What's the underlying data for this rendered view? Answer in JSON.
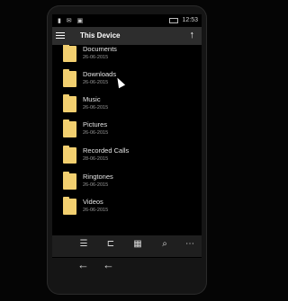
{
  "status_bar": {
    "time": "12:53"
  },
  "header": {
    "title": "This Device"
  },
  "folders": [
    {
      "name": "Documents",
      "date": "26-06-2015"
    },
    {
      "name": "Downloads",
      "date": "26-06-2015"
    },
    {
      "name": "Music",
      "date": "26-06-2015"
    },
    {
      "name": "Pictures",
      "date": "26-06-2015"
    },
    {
      "name": "Recorded Calls",
      "date": "28-06-2015"
    },
    {
      "name": "Ringtones",
      "date": "26-06-2015"
    },
    {
      "name": "Videos",
      "date": "26-06-2015"
    }
  ],
  "app_bar": {
    "buttons": [
      "list-icon",
      "select-icon",
      "grid-icon",
      "search-icon",
      "more-icon"
    ]
  },
  "nav_bar": {
    "buttons": [
      "back-icon",
      "back-icon"
    ]
  },
  "colors": {
    "folder": "#f2cf6f",
    "header_bg": "#2d2d2d",
    "screen_bg": "#000000"
  }
}
